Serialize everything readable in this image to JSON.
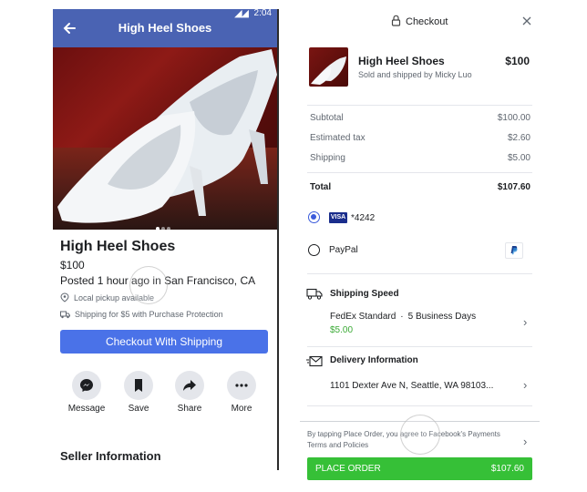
{
  "left": {
    "header_title": "High Heel Shoes",
    "status_time": "2:04",
    "product": {
      "title": "High Heel Shoes",
      "price": "$100",
      "posted": "Posted 1 hour ago in San Francisco, CA",
      "pickup": "Local pickup available",
      "shipping": "Shipping for $5 with Purchase Protection"
    },
    "checkout_button": "Checkout With Shipping",
    "actions": [
      "Message",
      "Save",
      "Share",
      "More"
    ],
    "seller_heading": "Seller Information",
    "photo_page": {
      "current": 1,
      "total": 3
    }
  },
  "right": {
    "header_title": "Checkout",
    "product": {
      "name": "High Heel Shoes",
      "sub": "Sold and shipped by Micky Luo",
      "price": "$100"
    },
    "summary": [
      {
        "label": "Subtotal",
        "value": "$100.00"
      },
      {
        "label": "Estimated tax",
        "value": "$2.60"
      },
      {
        "label": "Shipping",
        "value": "$5.00"
      }
    ],
    "total": {
      "label": "Total",
      "value": "$107.60"
    },
    "payment": {
      "card_brand": "VISA",
      "card_number": "*4242",
      "paypal_label": "PayPal",
      "selected": "card"
    },
    "shipping_speed": {
      "title": "Shipping Speed",
      "method": "FedEx Standard",
      "separator": "·",
      "eta": "5 Business Days",
      "price": "$5.00"
    },
    "delivery": {
      "title": "Delivery Information",
      "address": "1101 Dexter Ave N, Seattle, WA 98103..."
    },
    "terms": "By tapping Place Order, you agree to Facebook's Payments Terms and Policies",
    "place_order": {
      "label": "PLACE ORDER",
      "amount": "$107.60"
    }
  },
  "colors": {
    "header_blue": "#4a63b3",
    "button_blue": "#4a72e8",
    "radio_blue": "#3b5bdb",
    "green": "#36c037",
    "price_green": "#3aaa35"
  }
}
